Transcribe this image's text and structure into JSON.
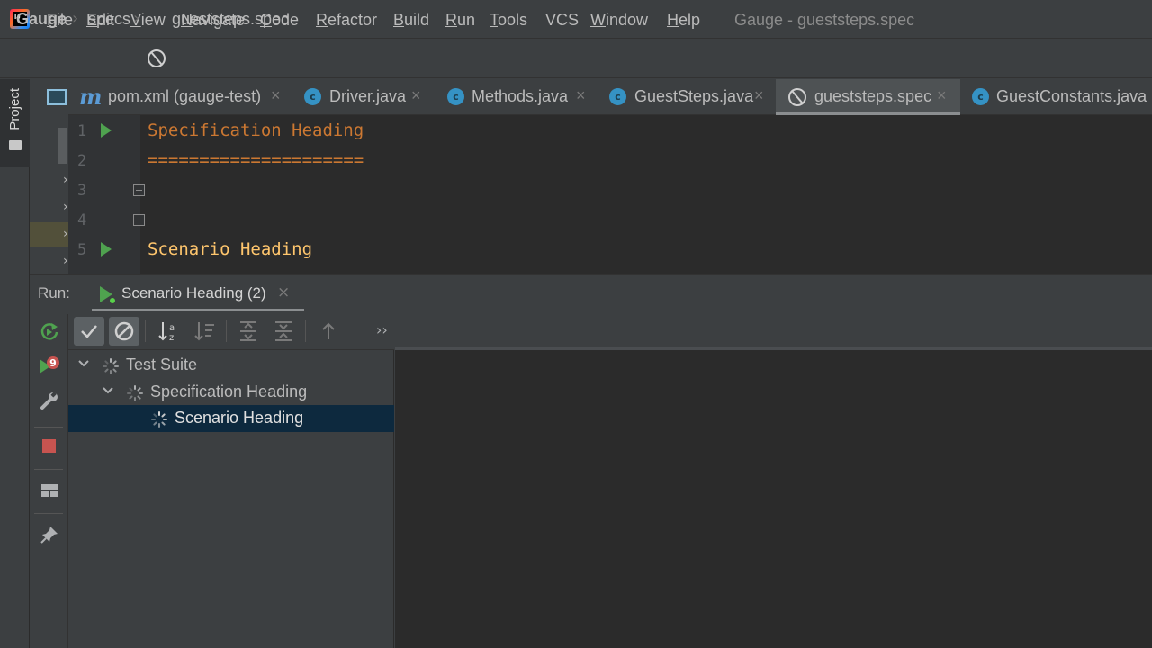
{
  "menubar": {
    "items": [
      {
        "u": "F",
        "rest": "ile"
      },
      {
        "u": "E",
        "rest": "dit"
      },
      {
        "u": "V",
        "rest": "iew"
      },
      {
        "u": "N",
        "rest": "avigate"
      },
      {
        "u": "C",
        "rest": "ode"
      },
      {
        "u": "R",
        "rest": "efactor"
      },
      {
        "u": "B",
        "rest": "uild"
      },
      {
        "u": "R",
        "rest": "un"
      },
      {
        "u": "T",
        "rest": "ools"
      },
      {
        "u": "",
        "rest": "VCS"
      },
      {
        "u": "W",
        "rest": "indow"
      },
      {
        "u": "H",
        "rest": "elp"
      }
    ],
    "window_title": "Gauge - gueststeps.spec",
    "logo_text": "IJ"
  },
  "breadcrumb": {
    "project": "Gauge",
    "folder": "specs",
    "file": "gueststeps.spec"
  },
  "sidebar": {
    "project_label": "Project"
  },
  "tabs": [
    {
      "label": "pom.xml (gauge-test)",
      "icon": "maven-icon"
    },
    {
      "label": "Driver.java",
      "icon": "java-class-icon"
    },
    {
      "label": "Methods.java",
      "icon": "java-class-icon"
    },
    {
      "label": "GuestSteps.java",
      "icon": "java-class-icon"
    },
    {
      "label": "gueststeps.spec",
      "icon": "gauge-spec-icon",
      "active": true
    },
    {
      "label": "GuestConstants.java",
      "icon": "java-class-icon"
    }
  ],
  "editor": {
    "lines": [
      {
        "num": "1",
        "text": "Specification Heading"
      },
      {
        "num": "2",
        "text": "====================="
      },
      {
        "num": "3",
        "text": ""
      },
      {
        "num": "4",
        "text": ""
      },
      {
        "num": "5",
        "text": "Scenario Heading"
      }
    ],
    "colors": {
      "heading": "#cc7832",
      "scenario": "#ffc66d"
    }
  },
  "run": {
    "label": "Run:",
    "tab_label": "Scenario Heading (2)",
    "badge_count": "9",
    "tree": [
      {
        "label": "Test Suite",
        "level": 0,
        "expanded": true
      },
      {
        "label": "Specification Heading",
        "level": 1,
        "expanded": true
      },
      {
        "label": "Scenario Heading",
        "level": 2,
        "selected": true
      }
    ]
  }
}
